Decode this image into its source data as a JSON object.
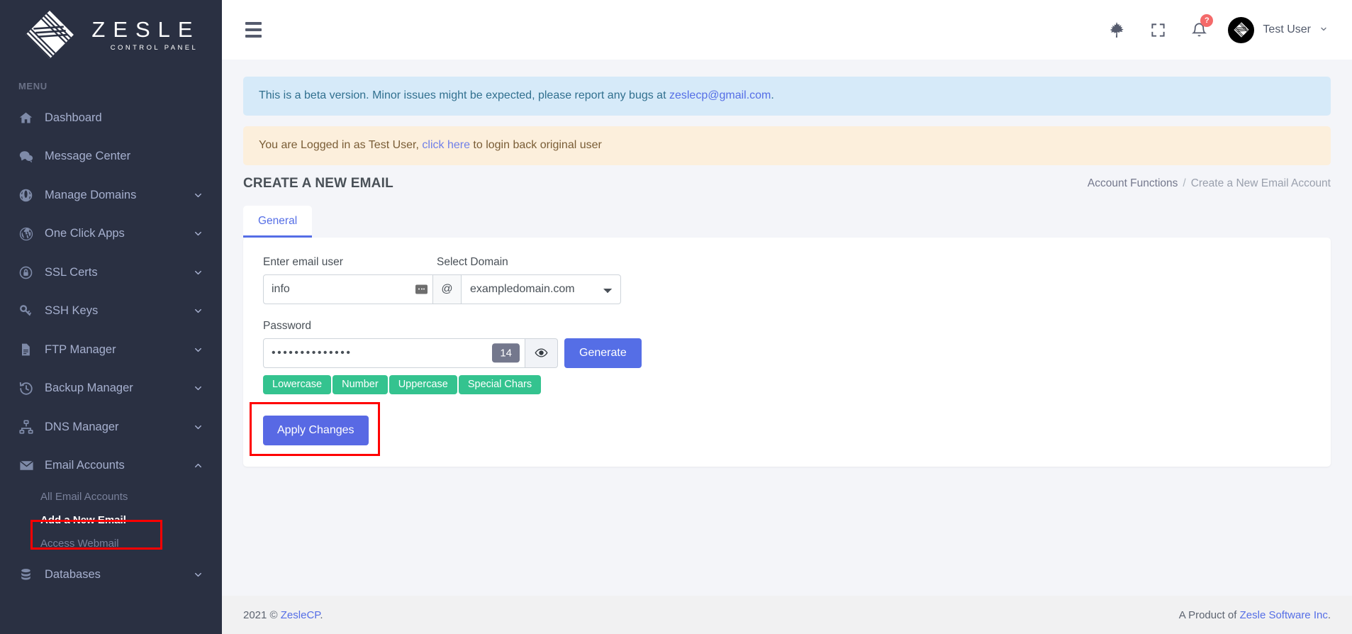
{
  "brand": {
    "word": "ZESLE",
    "sub": "CONTROL PANEL",
    "logo_icon": "zesle-diamond-logo"
  },
  "sidebar": {
    "menu_label": "MENU",
    "items": [
      {
        "label": "Dashboard",
        "icon": "home-icon",
        "caret": ""
      },
      {
        "label": "Message Center",
        "icon": "chat-bubbles-icon",
        "caret": ""
      },
      {
        "label": "Manage Domains",
        "icon": "globe-icon",
        "caret": "chevron-down-icon"
      },
      {
        "label": "One Click Apps",
        "icon": "wordpress-icon",
        "caret": "chevron-down-icon"
      },
      {
        "label": "SSL Certs",
        "icon": "lock-circle-icon",
        "caret": "chevron-down-icon"
      },
      {
        "label": "SSH Keys",
        "icon": "key-icon",
        "caret": "chevron-down-icon"
      },
      {
        "label": "FTP Manager",
        "icon": "document-icon",
        "caret": "chevron-down-icon"
      },
      {
        "label": "Backup Manager",
        "icon": "history-clock-icon",
        "caret": "chevron-down-icon"
      },
      {
        "label": "DNS Manager",
        "icon": "sitemap-icon",
        "caret": "chevron-down-icon"
      },
      {
        "label": "Email Accounts",
        "icon": "envelope-icon",
        "caret": "chevron-up-icon"
      }
    ],
    "email_sub_items": [
      {
        "label": "All Email Accounts",
        "active": false
      },
      {
        "label": "Add a New Email",
        "active": true
      },
      {
        "label": "Access Webmail",
        "active": false
      }
    ],
    "databases": {
      "label": "Databases",
      "icon": "database-icon",
      "caret": "chevron-down-icon"
    }
  },
  "topbar": {
    "hamburger_icon": "hamburger-menu-icon",
    "leaf_icon": "maple-leaf-icon",
    "fullscreen_icon": "fullscreen-expand-icon",
    "bell_icon": "bell-notification-icon",
    "bell_badge": "?",
    "avatar_icon": "zesle-avatar-icon",
    "user_name": "Test User",
    "user_caret_icon": "chevron-down-icon"
  },
  "alerts": {
    "beta": {
      "text_before": "This is a beta version. Minor issues might be expected, please report any bugs at ",
      "link": "zeslecp@gmail.com",
      "text_after": "."
    },
    "impersonate": {
      "text_before": "You are Logged in as Test User, ",
      "link": "click here",
      "text_after": " to login back original user"
    }
  },
  "page": {
    "title": "CREATE A NEW EMAIL",
    "breadcrumb_parent": "Account Functions",
    "breadcrumb_sep": "/",
    "breadcrumb_current": "Create a New Email Account"
  },
  "tabs": [
    {
      "label": "General",
      "active": true
    }
  ],
  "form": {
    "email_user_label": "Enter email user",
    "email_user_value": "info",
    "email_user_placeholder": "Enter email user",
    "autofill_icon": "autofill-keyboard-icon",
    "at_symbol": "@",
    "domain_label": "Select Domain",
    "domain_selected": "exampledomain.com",
    "domain_options": [
      "exampledomain.com"
    ],
    "password_label": "Password",
    "password_value": "••••••••••••••",
    "password_length": "14",
    "eye_icon": "eye-toggle-visibility-icon",
    "generate_label": "Generate",
    "chips": [
      "Lowercase",
      "Number",
      "Uppercase",
      "Special Chars"
    ],
    "apply_label": "Apply Changes"
  },
  "footer": {
    "left_text": "2021 © ",
    "left_link": "ZesleCP",
    "left_after": ".",
    "right_text": "A Product of ",
    "right_link": "Zesle Software Inc",
    "right_after": "."
  },
  "colors": {
    "sidebar_bg": "#2a3042",
    "accent_blue": "#556ee6",
    "chip_green": "#34c38f",
    "badge_red": "#f46a6a",
    "highlight_red": "#ff0000",
    "info_alert": "#d6eaf9",
    "warn_alert": "#fcefdc"
  }
}
